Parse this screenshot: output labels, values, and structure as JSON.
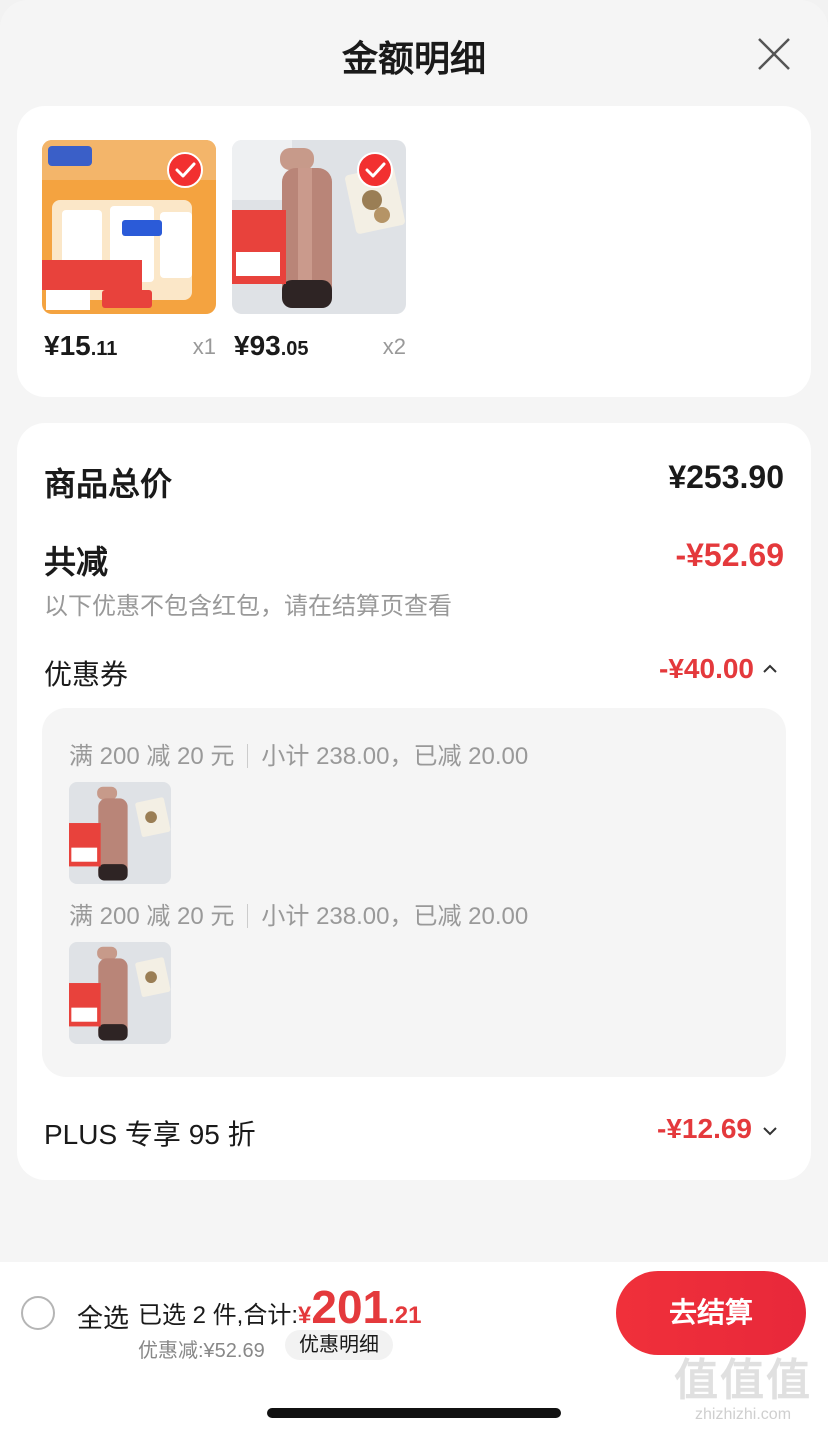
{
  "header": {
    "title": "金额明细"
  },
  "products": [
    {
      "price_main": "¥15",
      "price_cents": ".11",
      "qty": "x1",
      "thumb_icon": "paper-cups-product-image"
    },
    {
      "price_main": "¥93",
      "price_cents": ".05",
      "qty": "x2",
      "thumb_icon": "thermos-product-image"
    }
  ],
  "detail": {
    "total_label": "商品总价",
    "total_value": "¥253.90",
    "reduce_label": "共减",
    "reduce_value": "-¥52.69",
    "note": "以下优惠不包含红包，请在结算页查看",
    "coupon_label": "优惠券",
    "coupon_value": "-¥40.00",
    "coupon_rules": [
      {
        "rule": "满 200 减 20 元",
        "subtotal": "小计 238.00，已减 20.00"
      },
      {
        "rule": "满 200 减 20 元",
        "subtotal": "小计 238.00，已减 20.00"
      }
    ],
    "plus_label": "PLUS 专享 95 折",
    "plus_value": "-¥12.69"
  },
  "bottom": {
    "select_all": "全选",
    "selected_prefix": "已选 2 件,合计:",
    "total_currency": "¥",
    "total_int": "201",
    "total_cents": ".21",
    "discount_text": "优惠减:¥52.69",
    "detail_chip": "优惠明细",
    "checkout": "去结算"
  },
  "watermark": {
    "logo": "值值值",
    "url": "zhizhizhi.com"
  },
  "colors": {
    "accent": "#e4393c",
    "muted": "#999999"
  }
}
